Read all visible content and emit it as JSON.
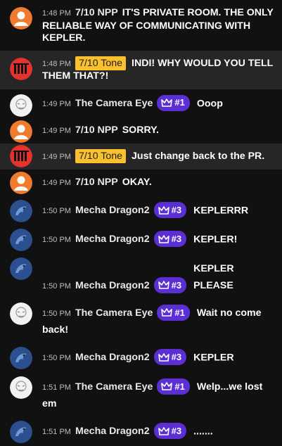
{
  "messages": [
    {
      "time": "1:48 PM",
      "author": "7/10 NPP",
      "avatar": "orange-person",
      "badge": null,
      "text": "IT'S PRIVATE ROOM. THE ONLY RELIABLE WAY OF COMMUNICATING WITH KEPLER.",
      "highlight": false
    },
    {
      "time": "1:48 PM",
      "author": "7/10 Tone",
      "avatar": "red-logo",
      "badge": "owner",
      "text": "INDI! WHY WOULD YOU TELL THEM THAT?!",
      "highlight": true
    },
    {
      "time": "1:49 PM",
      "author": "The Camera Eye",
      "avatar": "white-sketch",
      "badge": "member",
      "rank": "#1",
      "text": "Ooop",
      "highlight": false
    },
    {
      "time": "1:49 PM",
      "author": "7/10 NPP",
      "avatar": "orange-person",
      "badge": null,
      "text": "SORRY.",
      "highlight": false
    },
    {
      "time": "1:49 PM",
      "author": "7/10 Tone",
      "avatar": "red-logo",
      "badge": "owner",
      "text": "Just change back to the PR.",
      "highlight": true
    },
    {
      "time": "1:49 PM",
      "author": "7/10 NPP",
      "avatar": "orange-person",
      "badge": null,
      "text": "OKAY.",
      "highlight": false
    },
    {
      "time": "1:50 PM",
      "author": "Mecha Dragon2",
      "avatar": "blue-dragon",
      "badge": "member",
      "rank": "#3",
      "text": "KEPLERRR",
      "highlight": false
    },
    {
      "time": "1:50 PM",
      "author": "Mecha Dragon2",
      "avatar": "blue-dragon",
      "badge": "member",
      "rank": "#3",
      "text": "KEPLER!",
      "highlight": false
    },
    {
      "time": "1:50 PM",
      "author": "Mecha Dragon2",
      "avatar": "blue-dragon",
      "badge": "member",
      "rank": "#3",
      "text": "KEPLER PLEASE",
      "highlight": false
    },
    {
      "time": "1:50 PM",
      "author": "The Camera Eye",
      "avatar": "white-sketch",
      "badge": "member",
      "rank": "#1",
      "text": "Wait no come back!",
      "highlight": false
    },
    {
      "time": "1:50 PM",
      "author": "Mecha Dragon2",
      "avatar": "blue-dragon",
      "badge": "member",
      "rank": "#3",
      "text": "KEPLER",
      "highlight": false
    },
    {
      "time": "1:51 PM",
      "author": "The Camera Eye",
      "avatar": "white-sketch",
      "badge": "member",
      "rank": "#1",
      "text": "Welp...we lost em",
      "highlight": false
    },
    {
      "time": "1:51 PM",
      "author": "Mecha Dragon2",
      "avatar": "blue-dragon",
      "badge": "member",
      "rank": "#3",
      "text": ".......",
      "highlight": false
    }
  ],
  "colors": {
    "background": "#111111",
    "highlight_row": "#262626",
    "owner_badge": "#fbc02d",
    "member_badge": "#5b2fd4",
    "timestamp": "#bdbdbd"
  }
}
